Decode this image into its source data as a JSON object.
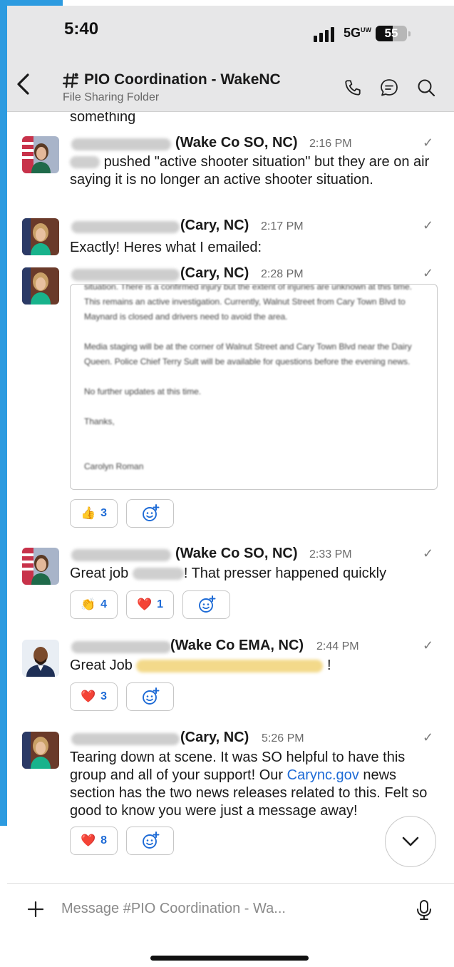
{
  "status_bar": {
    "time": "5:40",
    "network": "5G",
    "network_sup": "UW",
    "battery": "55",
    "battery_level_percent": 55
  },
  "header": {
    "channel_icon": "#",
    "channel_name": "PIO Coordination - WakeNC",
    "subtitle": "File Sharing Folder",
    "icons": [
      "back-chevron-icon",
      "phone-icon",
      "threads-icon",
      "search-icon"
    ]
  },
  "messages": [
    {
      "id": "m0",
      "text": "something"
    },
    {
      "id": "m1",
      "author_location": "(Wake Co SO, NC)",
      "time": "2:16 PM",
      "text": "pushed \"active shooter situation\" but they are on air saying it is no longer an active shooter situation."
    },
    {
      "id": "m2",
      "author_location": "(Cary, NC)",
      "time": "2:17 PM",
      "text": "Exactly! Heres what I emailed:"
    },
    {
      "id": "m3",
      "author_location": "(Cary, NC)",
      "time": "2:28 PM",
      "attachment_text": "situation. There is a confirmed injury but the extent of injuries are unknown at this time. This remains an active investigation. Currently, Walnut Street from Cary Town Blvd to Maynard is closed and drivers need to avoid the area.\n\nMedia staging will be at the corner of Walnut Street and Cary Town Blvd near the Dairy Queen. Police Chief Terry Sult will be available for questions before the evening news.\n\nNo further updates at this time.\n\nThanks,\n\n\nCarolyn Roman",
      "reactions": [
        {
          "emoji": "👍",
          "count": "3"
        }
      ]
    },
    {
      "id": "m4",
      "author_location": "(Wake Co SO, NC)",
      "time": "2:33 PM",
      "text_before": "Great job",
      "text_after": "! That presser happened quickly",
      "reactions": [
        {
          "emoji": "👏",
          "count": "4"
        },
        {
          "emoji": "❤️",
          "count": "1"
        }
      ]
    },
    {
      "id": "m5",
      "author_location": "(Wake Co EMA, NC)",
      "time": "2:44 PM",
      "text_before": "Great Job",
      "text_after": "!",
      "reactions": [
        {
          "emoji": "❤️",
          "count": "3"
        }
      ]
    },
    {
      "id": "m6",
      "author_location": "(Cary, NC)",
      "time": "5:26 PM",
      "text_before": "Tearing down at scene. It was SO helpful to have this group and all of your support! Our ",
      "link_text": "Carync.gov",
      "text_after": " news section has the two news releases related to this. Felt so good to know you were just a message away!",
      "reactions": [
        {
          "emoji": "❤️",
          "count": "8"
        }
      ]
    }
  ],
  "composer": {
    "placeholder": "Message #PIO Coordination - Wa..."
  },
  "colors": {
    "accent": "#1e6bd6",
    "left_strip": "#2d9be0",
    "header_bg": "#e7e7e8"
  }
}
